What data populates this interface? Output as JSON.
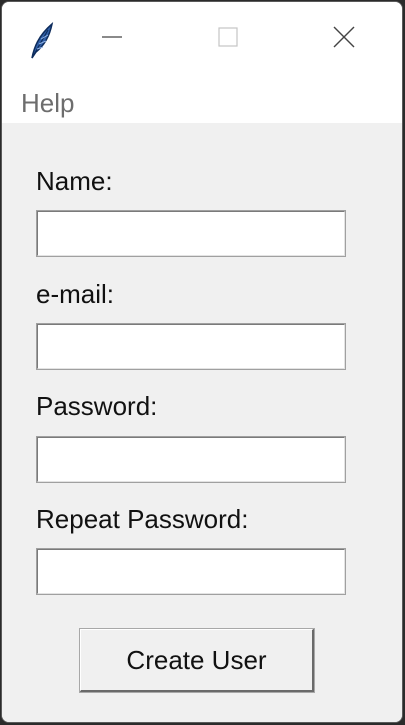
{
  "window": {
    "icon": "feather-icon",
    "controls": [
      "minimize-icon",
      "maximize-icon",
      "close-icon"
    ]
  },
  "menu": {
    "items": [
      {
        "label": "Help"
      }
    ]
  },
  "form": {
    "name_label": "Name:",
    "email_label": "e-mail:",
    "password_label": "Password:",
    "repeat_password_label": "Repeat Password:",
    "name_value": "",
    "email_value": "",
    "password_value": "",
    "repeat_password_value": "",
    "submit_label": "Create User"
  },
  "colors": {
    "window_bg": "#f0f0f0",
    "titlebar_bg": "#ffffff",
    "menu_text": "#6d6d6d",
    "icon_blue": "#2f5fa8"
  }
}
